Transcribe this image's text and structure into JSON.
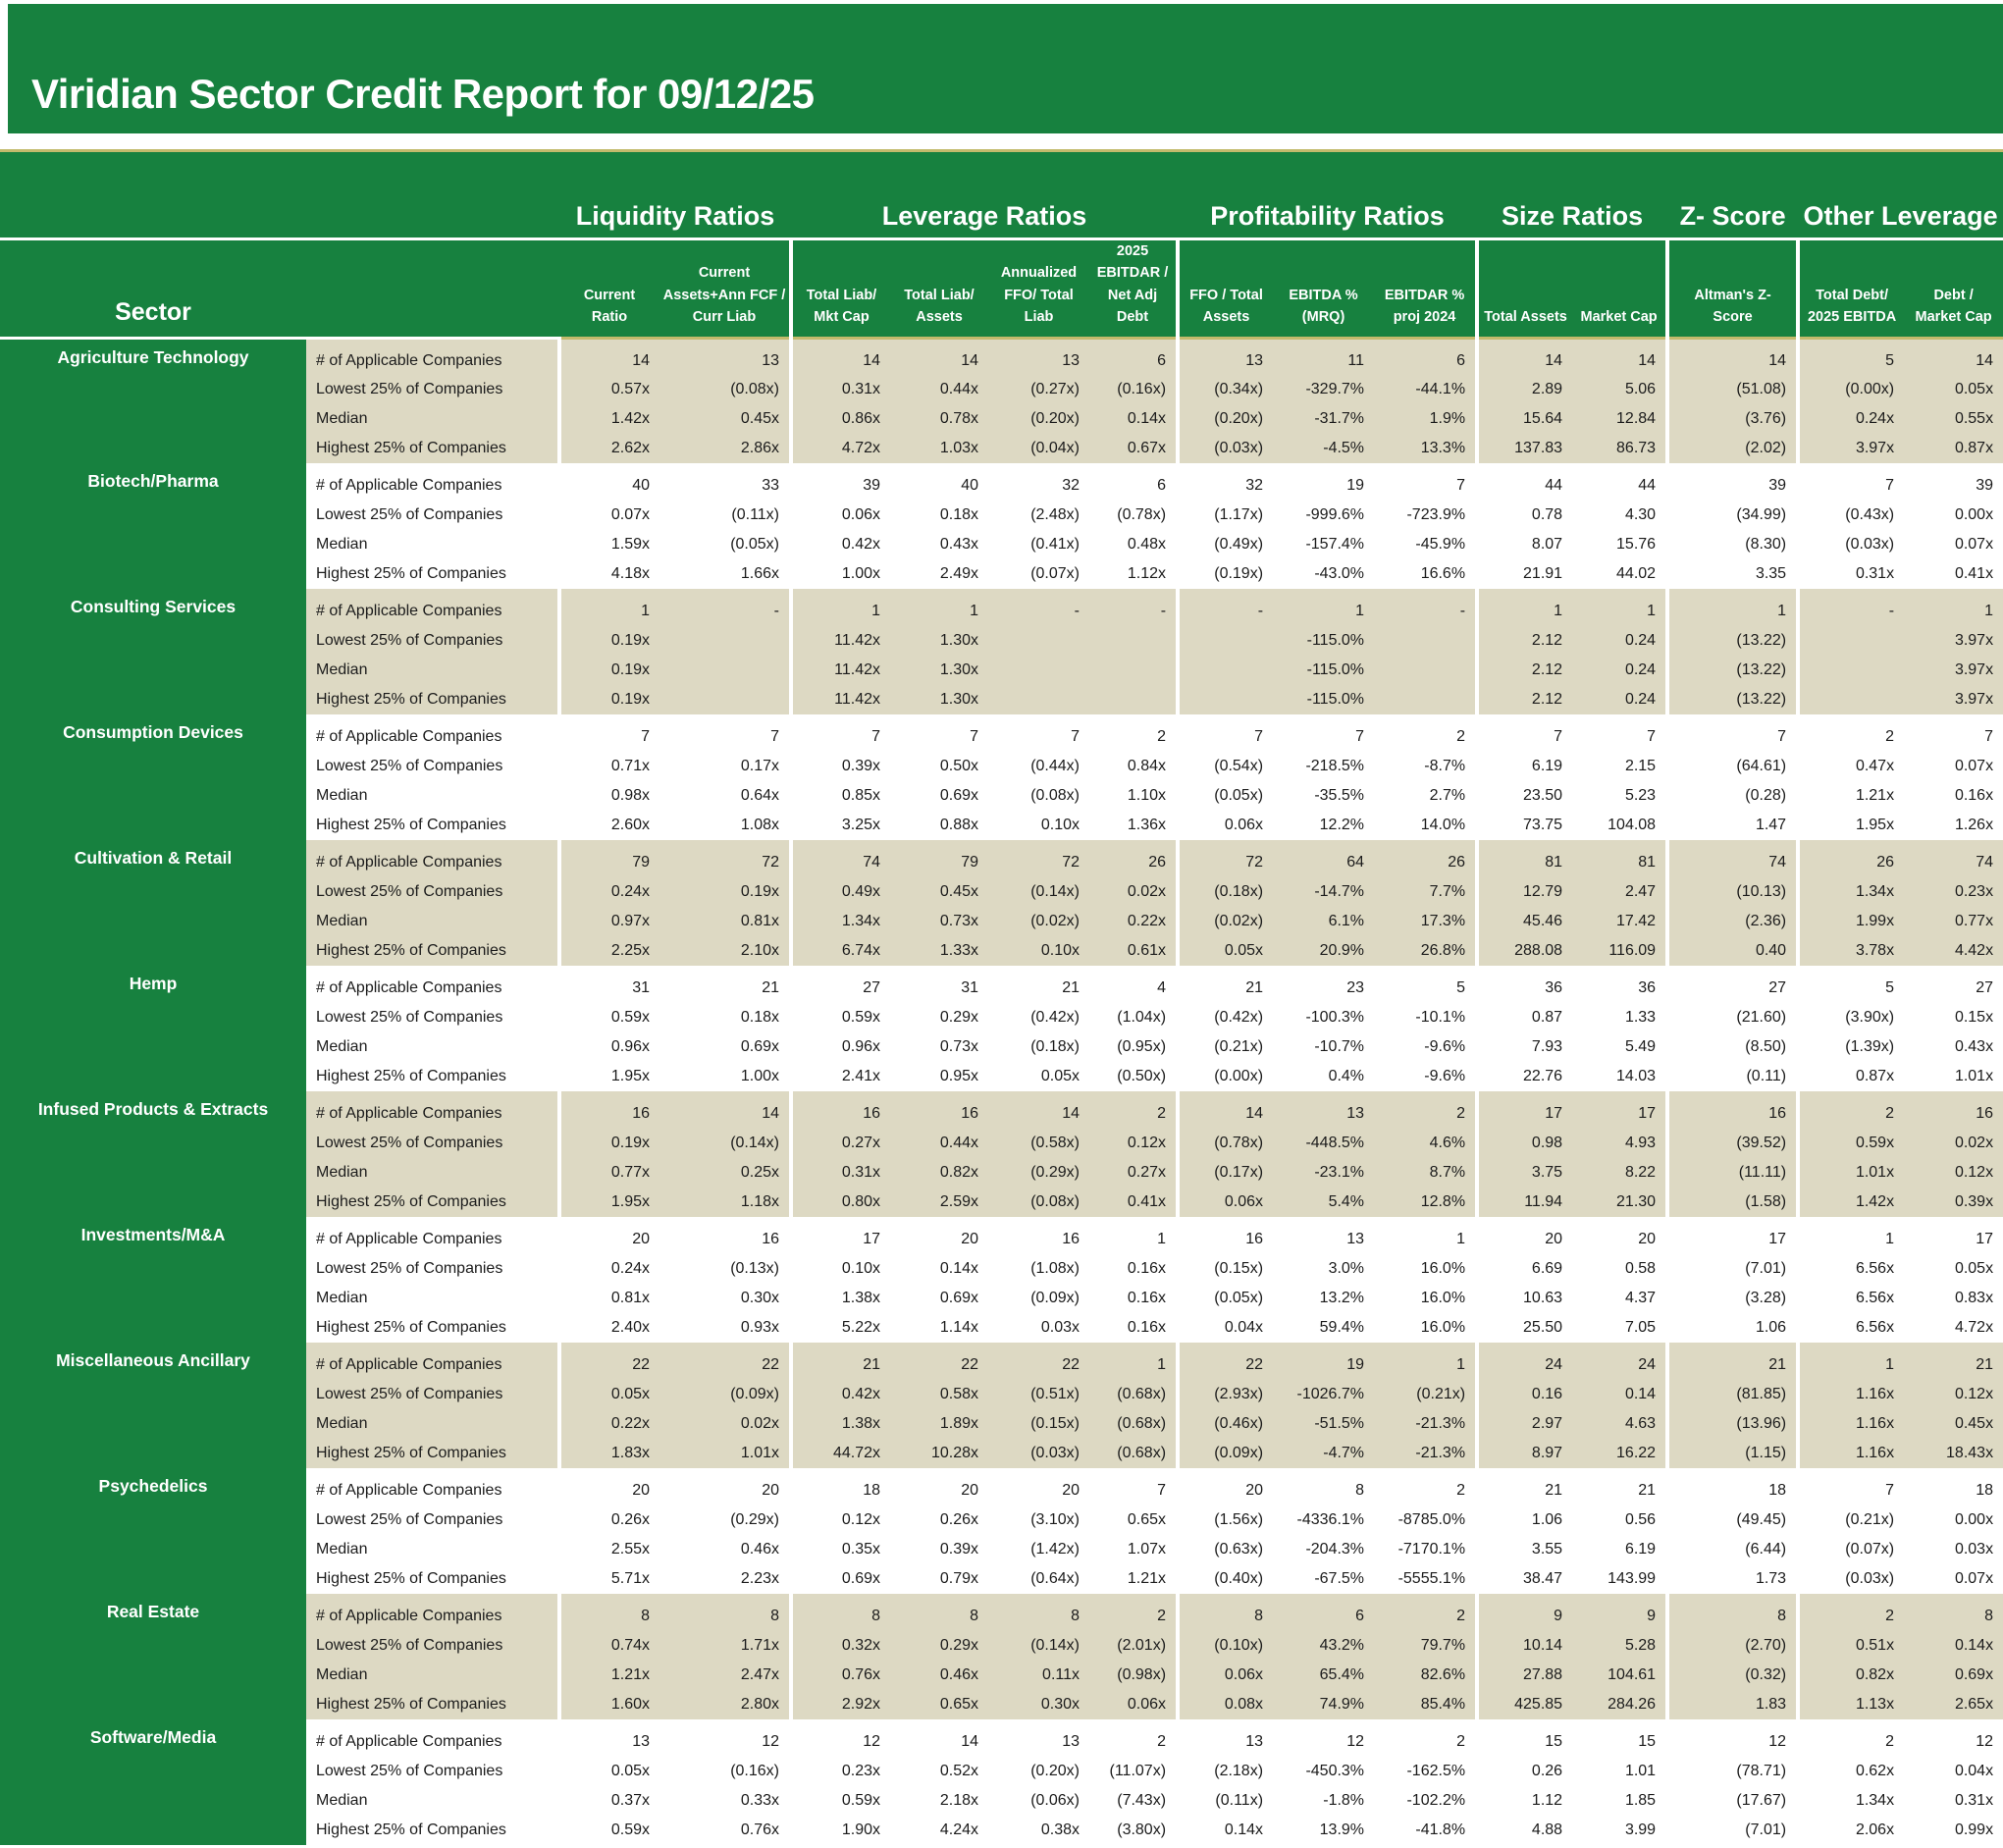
{
  "title": "Viridian Sector Credit Report for 09/12/25",
  "colors": {
    "green": "#17813F",
    "beige": "#DDD9C3",
    "olive": "#C3BA6C",
    "text": "#1C1C1C"
  },
  "header": {
    "sector_label": "Sector",
    "groups": [
      {
        "label": "Liquidity Ratios"
      },
      {
        "label": "Leverage Ratios"
      },
      {
        "label": "Profitability Ratios"
      },
      {
        "label": "Size Ratios"
      },
      {
        "label": "Z- Score"
      },
      {
        "label": "Other Leverage"
      }
    ],
    "columns": [
      "Current\nRatio",
      "Current\nAssets+Ann FCF /\nCurr Liab",
      "Total Liab/\nMkt Cap",
      "Total Liab/\nAssets",
      "Annualized\nFFO/ Total\nLiab",
      "2025\nEBITDAR /\nNet Adj\nDebt",
      "FFO / Total\nAssets",
      "EBITDA %\n(MRQ)",
      "EBITDAR %\nproj 2024",
      "Total Assets",
      "Market Cap",
      "Altman's Z-\nScore",
      "Total Debt/\n2025 EBITDA",
      "Debt /\nMarket Cap"
    ]
  },
  "row_labels": [
    "# of Applicable Companies",
    "Lowest 25% of Companies",
    "Median",
    "Highest 25% of Companies"
  ],
  "sectors": [
    {
      "name": "Agriculture Technology",
      "rows": [
        [
          "14",
          "13",
          "14",
          "14",
          "13",
          "6",
          "13",
          "11",
          "6",
          "14",
          "14",
          "14",
          "5",
          "14"
        ],
        [
          "0.57x",
          "(0.08x)",
          "0.31x",
          "0.44x",
          "(0.27x)",
          "(0.16x)",
          "(0.34x)",
          "-329.7%",
          "-44.1%",
          "2.89",
          "5.06",
          "(51.08)",
          "(0.00x)",
          "0.05x"
        ],
        [
          "1.42x",
          "0.45x",
          "0.86x",
          "0.78x",
          "(0.20x)",
          "0.14x",
          "(0.20x)",
          "-31.7%",
          "1.9%",
          "15.64",
          "12.84",
          "(3.76)",
          "0.24x",
          "0.55x"
        ],
        [
          "2.62x",
          "2.86x",
          "4.72x",
          "1.03x",
          "(0.04x)",
          "0.67x",
          "(0.03x)",
          "-4.5%",
          "13.3%",
          "137.83",
          "86.73",
          "(2.02)",
          "3.97x",
          "0.87x"
        ]
      ]
    },
    {
      "name": "Biotech/Pharma",
      "rows": [
        [
          "40",
          "33",
          "39",
          "40",
          "32",
          "6",
          "32",
          "19",
          "7",
          "44",
          "44",
          "39",
          "7",
          "39"
        ],
        [
          "0.07x",
          "(0.11x)",
          "0.06x",
          "0.18x",
          "(2.48x)",
          "(0.78x)",
          "(1.17x)",
          "-999.6%",
          "-723.9%",
          "0.78",
          "4.30",
          "(34.99)",
          "(0.43x)",
          "0.00x"
        ],
        [
          "1.59x",
          "(0.05x)",
          "0.42x",
          "0.43x",
          "(0.41x)",
          "0.48x",
          "(0.49x)",
          "-157.4%",
          "-45.9%",
          "8.07",
          "15.76",
          "(8.30)",
          "(0.03x)",
          "0.07x"
        ],
        [
          "4.18x",
          "1.66x",
          "1.00x",
          "2.49x",
          "(0.07x)",
          "1.12x",
          "(0.19x)",
          "-43.0%",
          "16.6%",
          "21.91",
          "44.02",
          "3.35",
          "0.31x",
          "0.41x"
        ]
      ]
    },
    {
      "name": "Consulting Services",
      "rows": [
        [
          "1",
          "-",
          "1",
          "1",
          "-",
          "-",
          "-",
          "1",
          "-",
          "1",
          "1",
          "1",
          "-",
          "1"
        ],
        [
          "0.19x",
          "",
          "11.42x",
          "1.30x",
          "",
          "",
          "",
          "-115.0%",
          "",
          "2.12",
          "0.24",
          "(13.22)",
          "",
          "3.97x"
        ],
        [
          "0.19x",
          "",
          "11.42x",
          "1.30x",
          "",
          "",
          "",
          "-115.0%",
          "",
          "2.12",
          "0.24",
          "(13.22)",
          "",
          "3.97x"
        ],
        [
          "0.19x",
          "",
          "11.42x",
          "1.30x",
          "",
          "",
          "",
          "-115.0%",
          "",
          "2.12",
          "0.24",
          "(13.22)",
          "",
          "3.97x"
        ]
      ]
    },
    {
      "name": "Consumption Devices",
      "rows": [
        [
          "7",
          "7",
          "7",
          "7",
          "7",
          "2",
          "7",
          "7",
          "2",
          "7",
          "7",
          "7",
          "2",
          "7"
        ],
        [
          "0.71x",
          "0.17x",
          "0.39x",
          "0.50x",
          "(0.44x)",
          "0.84x",
          "(0.54x)",
          "-218.5%",
          "-8.7%",
          "6.19",
          "2.15",
          "(64.61)",
          "0.47x",
          "0.07x"
        ],
        [
          "0.98x",
          "0.64x",
          "0.85x",
          "0.69x",
          "(0.08x)",
          "1.10x",
          "(0.05x)",
          "-35.5%",
          "2.7%",
          "23.50",
          "5.23",
          "(0.28)",
          "1.21x",
          "0.16x"
        ],
        [
          "2.60x",
          "1.08x",
          "3.25x",
          "0.88x",
          "0.10x",
          "1.36x",
          "0.06x",
          "12.2%",
          "14.0%",
          "73.75",
          "104.08",
          "1.47",
          "1.95x",
          "1.26x"
        ]
      ]
    },
    {
      "name": "Cultivation & Retail",
      "rows": [
        [
          "79",
          "72",
          "74",
          "79",
          "72",
          "26",
          "72",
          "64",
          "26",
          "81",
          "81",
          "74",
          "26",
          "74"
        ],
        [
          "0.24x",
          "0.19x",
          "0.49x",
          "0.45x",
          "(0.14x)",
          "0.02x",
          "(0.18x)",
          "-14.7%",
          "7.7%",
          "12.79",
          "2.47",
          "(10.13)",
          "1.34x",
          "0.23x"
        ],
        [
          "0.97x",
          "0.81x",
          "1.34x",
          "0.73x",
          "(0.02x)",
          "0.22x",
          "(0.02x)",
          "6.1%",
          "17.3%",
          "45.46",
          "17.42",
          "(2.36)",
          "1.99x",
          "0.77x"
        ],
        [
          "2.25x",
          "2.10x",
          "6.74x",
          "1.33x",
          "0.10x",
          "0.61x",
          "0.05x",
          "20.9%",
          "26.8%",
          "288.08",
          "116.09",
          "0.40",
          "3.78x",
          "4.42x"
        ]
      ]
    },
    {
      "name": "Hemp",
      "rows": [
        [
          "31",
          "21",
          "27",
          "31",
          "21",
          "4",
          "21",
          "23",
          "5",
          "36",
          "36",
          "27",
          "5",
          "27"
        ],
        [
          "0.59x",
          "0.18x",
          "0.59x",
          "0.29x",
          "(0.42x)",
          "(1.04x)",
          "(0.42x)",
          "-100.3%",
          "-10.1%",
          "0.87",
          "1.33",
          "(21.60)",
          "(3.90x)",
          "0.15x"
        ],
        [
          "0.96x",
          "0.69x",
          "0.96x",
          "0.73x",
          "(0.18x)",
          "(0.95x)",
          "(0.21x)",
          "-10.7%",
          "-9.6%",
          "7.93",
          "5.49",
          "(8.50)",
          "(1.39x)",
          "0.43x"
        ],
        [
          "1.95x",
          "1.00x",
          "2.41x",
          "0.95x",
          "0.05x",
          "(0.50x)",
          "(0.00x)",
          "0.4%",
          "-9.6%",
          "22.76",
          "14.03",
          "(0.11)",
          "0.87x",
          "1.01x"
        ]
      ]
    },
    {
      "name": "Infused Products & Extracts",
      "rows": [
        [
          "16",
          "14",
          "16",
          "16",
          "14",
          "2",
          "14",
          "13",
          "2",
          "17",
          "17",
          "16",
          "2",
          "16"
        ],
        [
          "0.19x",
          "(0.14x)",
          "0.27x",
          "0.44x",
          "(0.58x)",
          "0.12x",
          "(0.78x)",
          "-448.5%",
          "4.6%",
          "0.98",
          "4.93",
          "(39.52)",
          "0.59x",
          "0.02x"
        ],
        [
          "0.77x",
          "0.25x",
          "0.31x",
          "0.82x",
          "(0.29x)",
          "0.27x",
          "(0.17x)",
          "-23.1%",
          "8.7%",
          "3.75",
          "8.22",
          "(11.11)",
          "1.01x",
          "0.12x"
        ],
        [
          "1.95x",
          "1.18x",
          "0.80x",
          "2.59x",
          "(0.08x)",
          "0.41x",
          "0.06x",
          "5.4%",
          "12.8%",
          "11.94",
          "21.30",
          "(1.58)",
          "1.42x",
          "0.39x"
        ]
      ]
    },
    {
      "name": "Investments/M&A",
      "rows": [
        [
          "20",
          "16",
          "17",
          "20",
          "16",
          "1",
          "16",
          "13",
          "1",
          "20",
          "20",
          "17",
          "1",
          "17"
        ],
        [
          "0.24x",
          "(0.13x)",
          "0.10x",
          "0.14x",
          "(1.08x)",
          "0.16x",
          "(0.15x)",
          "3.0%",
          "16.0%",
          "6.69",
          "0.58",
          "(7.01)",
          "6.56x",
          "0.05x"
        ],
        [
          "0.81x",
          "0.30x",
          "1.38x",
          "0.69x",
          "(0.09x)",
          "0.16x",
          "(0.05x)",
          "13.2%",
          "16.0%",
          "10.63",
          "4.37",
          "(3.28)",
          "6.56x",
          "0.83x"
        ],
        [
          "2.40x",
          "0.93x",
          "5.22x",
          "1.14x",
          "0.03x",
          "0.16x",
          "0.04x",
          "59.4%",
          "16.0%",
          "25.50",
          "7.05",
          "1.06",
          "6.56x",
          "4.72x"
        ]
      ]
    },
    {
      "name": "Miscellaneous Ancillary",
      "rows": [
        [
          "22",
          "22",
          "21",
          "22",
          "22",
          "1",
          "22",
          "19",
          "1",
          "24",
          "24",
          "21",
          "1",
          "21"
        ],
        [
          "0.05x",
          "(0.09x)",
          "0.42x",
          "0.58x",
          "(0.51x)",
          "(0.68x)",
          "(2.93x)",
          "-1026.7%",
          "(0.21x)",
          "0.16",
          "0.14",
          "(81.85)",
          "1.16x",
          "0.12x"
        ],
        [
          "0.22x",
          "0.02x",
          "1.38x",
          "1.89x",
          "(0.15x)",
          "(0.68x)",
          "(0.46x)",
          "-51.5%",
          "-21.3%",
          "2.97",
          "4.63",
          "(13.96)",
          "1.16x",
          "0.45x"
        ],
        [
          "1.83x",
          "1.01x",
          "44.72x",
          "10.28x",
          "(0.03x)",
          "(0.68x)",
          "(0.09x)",
          "-4.7%",
          "-21.3%",
          "8.97",
          "16.22",
          "(1.15)",
          "1.16x",
          "18.43x"
        ]
      ]
    },
    {
      "name": "Psychedelics",
      "rows": [
        [
          "20",
          "20",
          "18",
          "20",
          "20",
          "7",
          "20",
          "8",
          "2",
          "21",
          "21",
          "18",
          "7",
          "18"
        ],
        [
          "0.26x",
          "(0.29x)",
          "0.12x",
          "0.26x",
          "(3.10x)",
          "0.65x",
          "(1.56x)",
          "-4336.1%",
          "-8785.0%",
          "1.06",
          "0.56",
          "(49.45)",
          "(0.21x)",
          "0.00x"
        ],
        [
          "2.55x",
          "0.46x",
          "0.35x",
          "0.39x",
          "(1.42x)",
          "1.07x",
          "(0.63x)",
          "-204.3%",
          "-7170.1%",
          "3.55",
          "6.19",
          "(6.44)",
          "(0.07x)",
          "0.03x"
        ],
        [
          "5.71x",
          "2.23x",
          "0.69x",
          "0.79x",
          "(0.64x)",
          "1.21x",
          "(0.40x)",
          "-67.5%",
          "-5555.1%",
          "38.47",
          "143.99",
          "1.73",
          "(0.03x)",
          "0.07x"
        ]
      ]
    },
    {
      "name": "Real Estate",
      "rows": [
        [
          "8",
          "8",
          "8",
          "8",
          "8",
          "2",
          "8",
          "6",
          "2",
          "9",
          "9",
          "8",
          "2",
          "8"
        ],
        [
          "0.74x",
          "1.71x",
          "0.32x",
          "0.29x",
          "(0.14x)",
          "(2.01x)",
          "(0.10x)",
          "43.2%",
          "79.7%",
          "10.14",
          "5.28",
          "(2.70)",
          "0.51x",
          "0.14x"
        ],
        [
          "1.21x",
          "2.47x",
          "0.76x",
          "0.46x",
          "0.11x",
          "(0.98x)",
          "0.06x",
          "65.4%",
          "82.6%",
          "27.88",
          "104.61",
          "(0.32)",
          "0.82x",
          "0.69x"
        ],
        [
          "1.60x",
          "2.80x",
          "2.92x",
          "0.65x",
          "0.30x",
          "0.06x",
          "0.08x",
          "74.9%",
          "85.4%",
          "425.85",
          "284.26",
          "1.83",
          "1.13x",
          "2.65x"
        ]
      ]
    },
    {
      "name": "Software/Media",
      "rows": [
        [
          "13",
          "12",
          "12",
          "14",
          "13",
          "2",
          "13",
          "12",
          "2",
          "15",
          "15",
          "12",
          "2",
          "12"
        ],
        [
          "0.05x",
          "(0.16x)",
          "0.23x",
          "0.52x",
          "(0.20x)",
          "(11.07x)",
          "(2.18x)",
          "-450.3%",
          "-162.5%",
          "0.26",
          "1.01",
          "(78.71)",
          "0.62x",
          "0.04x"
        ],
        [
          "0.37x",
          "0.33x",
          "0.59x",
          "2.18x",
          "(0.06x)",
          "(7.43x)",
          "(0.11x)",
          "-1.8%",
          "-102.2%",
          "1.12",
          "1.85",
          "(17.67)",
          "1.34x",
          "0.31x"
        ],
        [
          "0.59x",
          "0.76x",
          "1.90x",
          "4.24x",
          "0.38x",
          "(3.80x)",
          "0.14x",
          "13.9%",
          "-41.8%",
          "4.88",
          "3.99",
          "(7.01)",
          "2.06x",
          "0.99x"
        ]
      ]
    }
  ]
}
